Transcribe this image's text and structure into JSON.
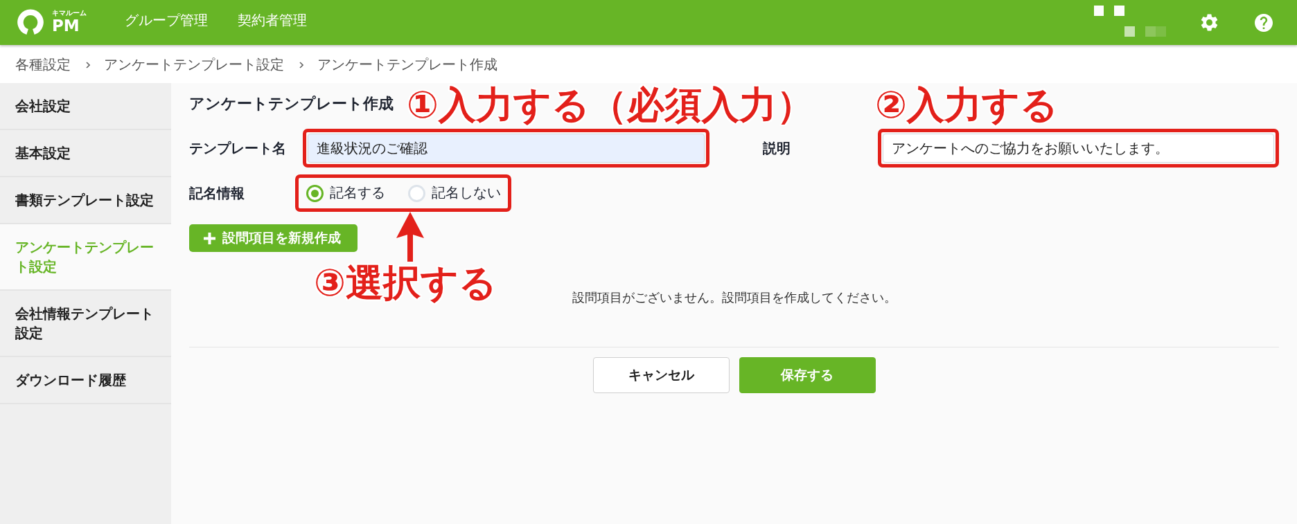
{
  "header": {
    "logo": {
      "subtitle": "キマルーム",
      "title": "PM"
    },
    "nav": [
      {
        "label": "グループ管理"
      },
      {
        "label": "契約者管理"
      }
    ]
  },
  "breadcrumb": [
    {
      "label": "各種設定"
    },
    {
      "label": "アンケートテンプレート設定"
    },
    {
      "label": "アンケートテンプレート作成"
    }
  ],
  "sidebar": {
    "items": [
      {
        "label": "会社設定",
        "selected": false
      },
      {
        "label": "基本設定",
        "selected": false
      },
      {
        "label": "書類テンプレート設定",
        "selected": false
      },
      {
        "label": "アンケートテンプレート設定",
        "selected": true
      },
      {
        "label": "会社情報テンプレート設定",
        "selected": false
      },
      {
        "label": "ダウンロード履歴",
        "selected": false
      }
    ]
  },
  "form": {
    "title": "アンケートテンプレート作成",
    "fields": [
      {
        "label": "テンプレート名",
        "value": "進級状況のご確認",
        "autofilled": true,
        "highlighted": true,
        "annotation": "①入力する（必須入力）"
      },
      {
        "label": "説明",
        "value": "アンケートへのご協力をお願いいたします。",
        "autofilled": false,
        "highlighted": true,
        "annotation": "②入力する"
      }
    ],
    "signature": {
      "label": "記名情報",
      "highlighted": true,
      "arrow": true,
      "annotation": "③選択する",
      "options": [
        {
          "label": "記名する",
          "selected": true
        },
        {
          "label": "記名しない",
          "selected": false
        }
      ]
    },
    "add_button": {
      "label": "設問項目を新規作成"
    },
    "empty_message": "設問項目がございません。設問項目を作成してください。",
    "buttons": [
      {
        "label": "キャンセル",
        "kind": "secondary"
      },
      {
        "label": "保存する",
        "kind": "primary"
      }
    ]
  }
}
